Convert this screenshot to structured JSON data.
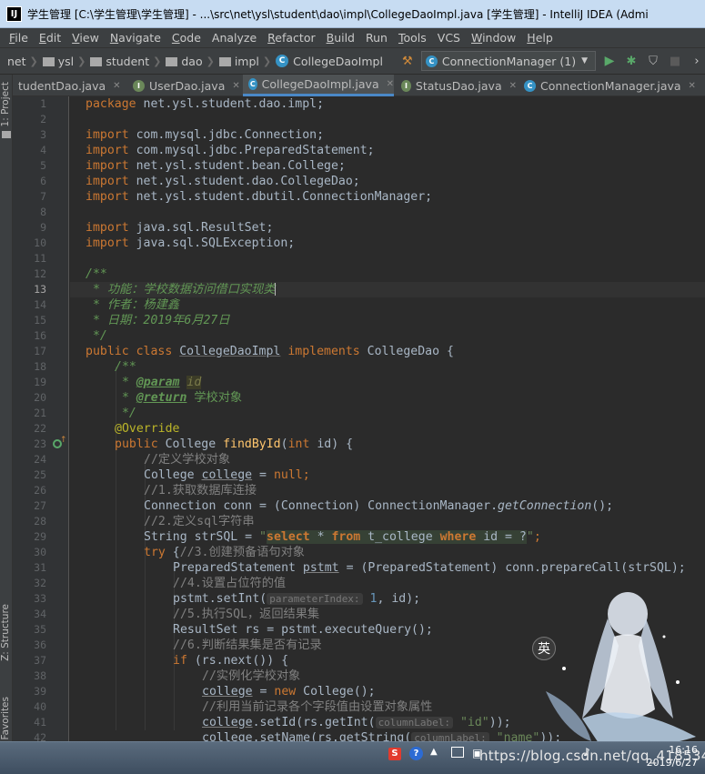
{
  "window": {
    "title": "学生管理 [C:\\学生管理\\学生管理] - ...\\src\\net\\ysl\\student\\dao\\impl\\CollegeDaoImpl.java [学生管理] - IntelliJ IDEA (Admi",
    "app_icon_text": "IJ"
  },
  "menu": [
    {
      "u": "F",
      "rest": "ile"
    },
    {
      "u": "E",
      "rest": "dit"
    },
    {
      "u": "V",
      "rest": "iew"
    },
    {
      "u": "N",
      "rest": "avigate"
    },
    {
      "u": "C",
      "rest": "ode"
    },
    {
      "u": "",
      "rest": "Analyze"
    },
    {
      "u": "R",
      "rest": "efactor"
    },
    {
      "u": "B",
      "rest": "uild"
    },
    {
      "u": "",
      "rest": "Run"
    },
    {
      "u": "T",
      "rest": "ools"
    },
    {
      "u": "",
      "rest": "VCS"
    },
    {
      "u": "W",
      "rest": "indow"
    },
    {
      "u": "H",
      "rest": "elp"
    }
  ],
  "breadcrumbs": [
    "net",
    "ysl",
    "student",
    "dao",
    "impl",
    "CollegeDaoImpl"
  ],
  "run_config": "ConnectionManager (1)",
  "class_icon_letter": "C",
  "interface_icon_letter": "I",
  "tabs": [
    {
      "label": "tudentDao.java"
    },
    {
      "label": "UserDao.java"
    },
    {
      "label": "CollegeDaoImpl.java"
    },
    {
      "label": "StatusDao.java"
    },
    {
      "label": "ConnectionManager.java"
    }
  ],
  "tool_windows": {
    "project": "1: Project",
    "structure": "Z: Structure",
    "favorites": "Favorites"
  },
  "editor": {
    "line_numbers": [
      "1",
      "2",
      "3",
      "4",
      "5",
      "6",
      "7",
      "8",
      "9",
      "10",
      "11",
      "12",
      "13",
      "14",
      "15",
      "16",
      "17",
      "18",
      "19",
      "20",
      "21",
      "22",
      "23",
      "24",
      "25",
      "26",
      "27",
      "28",
      "29",
      "30",
      "31",
      "32",
      "33",
      "34",
      "35",
      "36",
      "37",
      "38",
      "39",
      "40",
      "41",
      "42"
    ],
    "current_line": 13,
    "code": {
      "package_kw": "package",
      "package_name": " net.ysl.student.dao.impl;",
      "import_kw": "import",
      "imp1": " com.mysql.jdbc.Connection;",
      "imp2": " com.mysql.jdbc.PreparedStatement;",
      "imp3": " net.ysl.student.bean.College;",
      "imp4": " net.ysl.student.dao.CollegeDao;",
      "imp5": " net.ysl.student.dbutil.ConnectionManager;",
      "imp6": " java.sql.ResultSet;",
      "imp7": " java.sql.SQLException;",
      "doc_open": "/**",
      "doc13": " * 功能：学校数据访问借口实现类",
      "doc14": " * 作者：杨建鑫",
      "doc15": " * 日期：",
      "doc15_date": "2019年6月27日",
      "doc_close": " */",
      "l17_public": "public ",
      "l17_class": "class ",
      "l17_name": "CollegeDaoImpl",
      "l17_impl": " implements ",
      "l17_iface": "CollegeDao {",
      "l18": "/**",
      "l19_star": " * ",
      "l19_tag": "@param",
      "l19_id": "id",
      "l20_star": " * ",
      "l20_tag": "@return",
      "l20_text": " 学校对象",
      "l21": " */",
      "l22": "@Override",
      "l23_public": "public ",
      "l23_type": "College ",
      "l23_fn": "findById",
      "l23_p1": "(",
      "l23_int": "int",
      "l23_rest": " id) {",
      "l24": "//定义学校对象",
      "l25_a": "College ",
      "l25_var": "college",
      "l25_b": " = ",
      "l25_null": "null",
      "l25_c": ";",
      "l26": "//1.获取数据库连接",
      "l27_a": "Connection conn = (Connection) ConnectionManager.",
      "l27_m": "getConnection",
      "l27_b": "();",
      "l28": "//2.定义sql字符串",
      "l29_a": "String strSQL = ",
      "l29_q1": "\"",
      "l29_s1": "select",
      "l29_s2": " * ",
      "l29_s3": "from",
      "l29_s4": " t_college ",
      "l29_s5": "where",
      "l29_s6": " id = ?",
      "l29_q2": "\"",
      "l29_end": ";",
      "l30_try": "try ",
      "l30_brace": "{",
      "l30_cm": "//3.创建预备语句对象",
      "l31_a": "PreparedStatement ",
      "l31_var": "pstmt",
      "l31_b": " = (PreparedStatement) conn.prepareCall(strSQL);",
      "l32": "//4.设置占位符的值",
      "l33_a": "pstmt.setInt(",
      "l33_hint": "parameterIndex:",
      "l33_num": " 1",
      "l33_b": ", id);",
      "l34": "//5.执行SQL，返回结果集",
      "l35": "ResultSet rs = pstmt.executeQuery();",
      "l36": "//6.判断结果集是否有记录",
      "l37_if": "if ",
      "l37_rest": "(rs.next()) {",
      "l38": "//实例化学校对象",
      "l39_var": "college",
      "l39_a": " = ",
      "l39_new": "new ",
      "l39_b": "College();",
      "l40": "//利用当前记录各个字段值由设置对象属性",
      "l41_var": "college",
      "l41_a": ".setId(rs.getInt(",
      "l41_hint": "columnLabel:",
      "l41_str": " \"id\"",
      "l41_b": "));",
      "l42_var": "college",
      "l42_a": ".setName(rs.getString(",
      "l42_hint": "columnLabel:",
      "l42_str": " \"name\"",
      "l42_b": "));"
    }
  },
  "taskbar": {
    "time": "16:16",
    "date": "2019/6/27",
    "watermark": "https://blog.csdn.net/qq_41853417",
    "ime_label": "英"
  }
}
